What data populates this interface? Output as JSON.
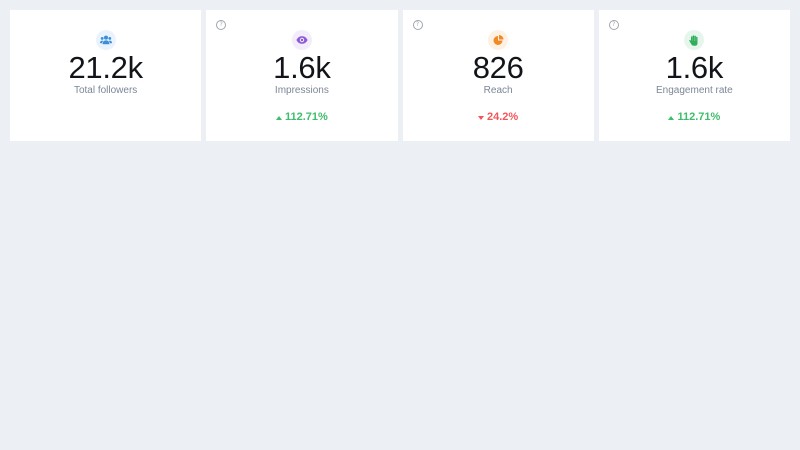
{
  "help_glyph": "?",
  "cards": [
    {
      "icon": "users-icon",
      "icon_color": "#3a8fd9",
      "icon_bg": "#eaf3fc",
      "value": "21.2k",
      "label": "Total followers"
    },
    {
      "icon": "eye-icon",
      "icon_color": "#8b5ad6",
      "icon_bg": "#f2ecfb",
      "value": "1.6k",
      "label": "Impressions",
      "change": "112.71%",
      "direction": "up"
    },
    {
      "icon": "pie-chart-icon",
      "icon_color": "#f08a24",
      "icon_bg": "#fdf1e4",
      "value": "826",
      "label": "Reach",
      "change": "24.2%",
      "direction": "down"
    },
    {
      "icon": "hand-icon",
      "icon_color": "#2fae5c",
      "icon_bg": "#e7f6ec",
      "value": "1.6k",
      "label": "Engagement rate",
      "change": "112.71%",
      "direction": "up"
    }
  ],
  "colors": {
    "background": "#ecf0f5",
    "card": "#ffffff",
    "up": "#3ebd6b",
    "down": "#f0565a"
  }
}
